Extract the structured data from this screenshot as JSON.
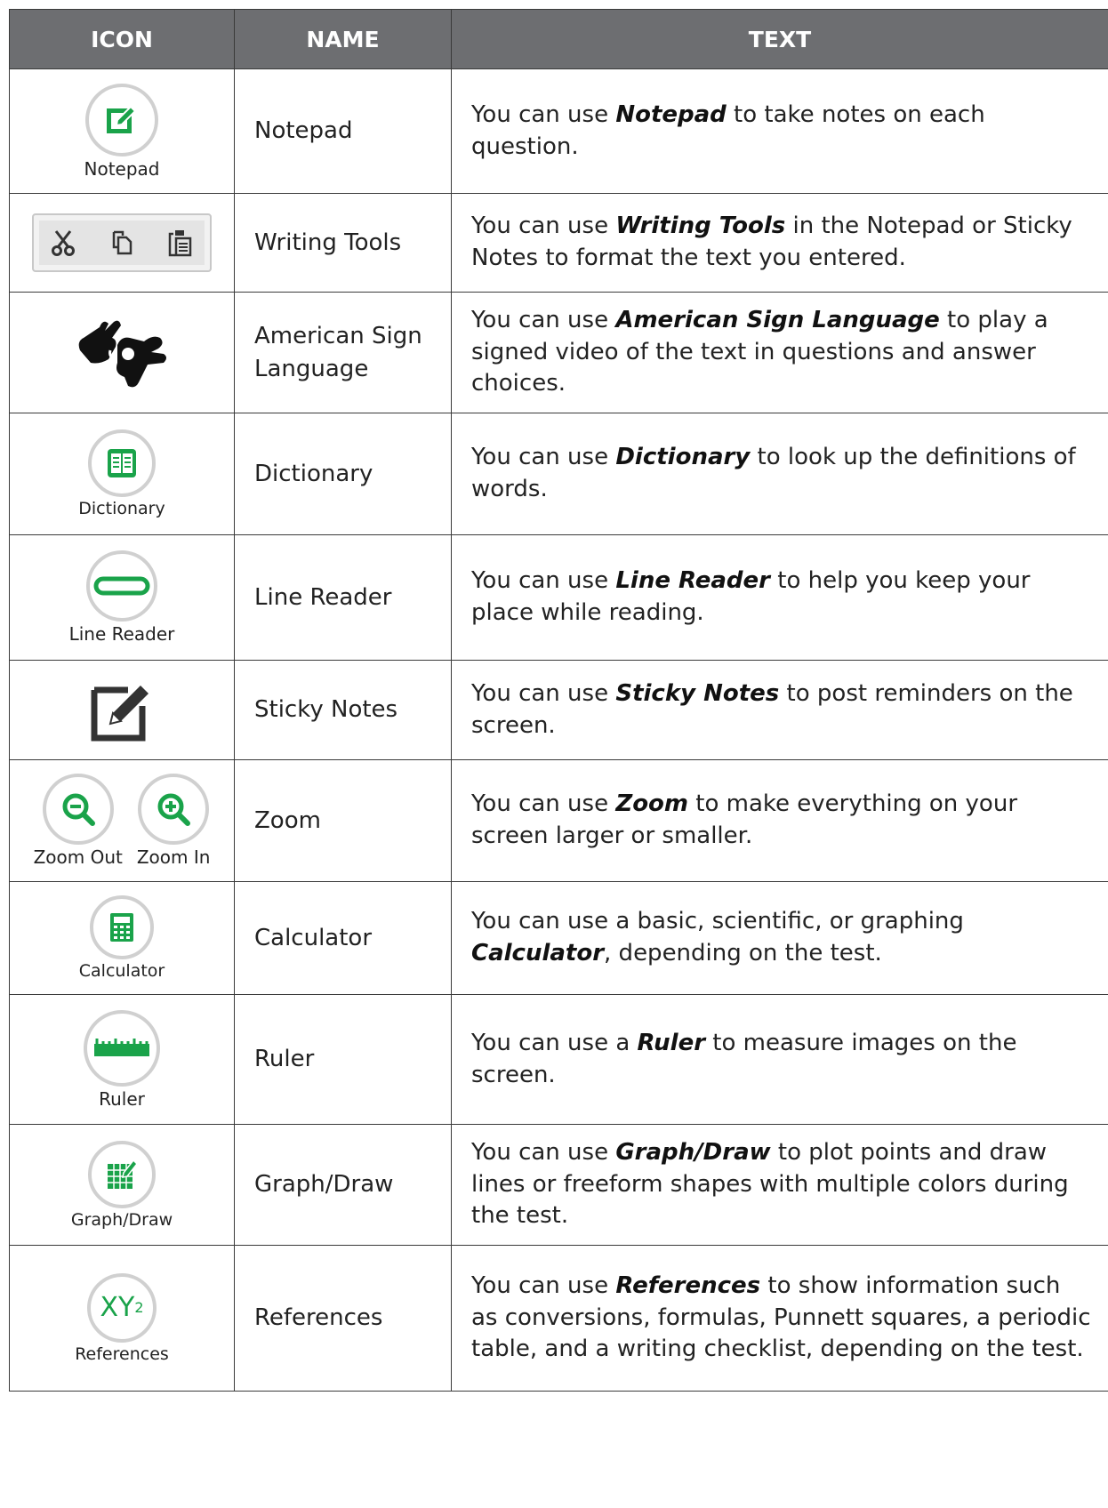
{
  "headers": {
    "icon": "ICON",
    "name": "NAME",
    "text": "TEXT"
  },
  "colors": {
    "header_bg": "#6d6e71",
    "accent_green": "#1aa34a",
    "circle_border": "#d0d0d0"
  },
  "rows": [
    {
      "icon_caption": "Notepad",
      "icon": "notepad-icon",
      "name": "Notepad",
      "text_pre": "You can use ",
      "text_bold": "Notepad",
      "text_post": " to take notes on each question."
    },
    {
      "icon": "writing-tools-icon",
      "name": "Writing Tools",
      "text_pre": "You can use ",
      "text_bold": "Writing Tools",
      "text_post": " in the Notepad or Sticky Notes to format the text you entered."
    },
    {
      "icon": "asl-hands-icon",
      "name": "American Sign Language",
      "text_pre": "You can use ",
      "text_bold": "American Sign Language",
      "text_post": " to play a signed video of the text in questions and answer choices."
    },
    {
      "icon_caption": "Dictionary",
      "icon": "dictionary-book-icon",
      "name": "Dictionary",
      "text_pre": "You can use ",
      "text_bold": "Dictionary",
      "text_post": " to look up the definitions of words."
    },
    {
      "icon_caption": "Line Reader",
      "icon": "line-reader-icon",
      "name": "Line Reader",
      "text_pre": "You can use ",
      "text_bold": "Line Reader",
      "text_post": " to help you keep your place while reading."
    },
    {
      "icon": "sticky-note-pencil-icon",
      "name": "Sticky Notes",
      "text_pre": "You can use ",
      "text_bold": "Sticky Notes",
      "text_post": " to post reminders on the screen."
    },
    {
      "icon_caption_out": "Zoom Out",
      "icon_caption_in": "Zoom In",
      "icon": "zoom-icons",
      "name": "Zoom",
      "text_pre": "You can use ",
      "text_bold": "Zoom",
      "text_post": " to make everything on your screen larger or smaller."
    },
    {
      "icon_caption": "Calculator",
      "icon": "calculator-icon",
      "name": "Calculator",
      "text_pre": "You can use a basic, scientific, or graphing ",
      "text_bold": "Calculator",
      "text_post": ", depending on the test."
    },
    {
      "icon_caption": "Ruler",
      "icon": "ruler-icon",
      "name": "Ruler",
      "text_pre": "You can use a ",
      "text_bold": "Ruler",
      "text_post": " to measure images on the screen."
    },
    {
      "icon_caption": "Graph/Draw",
      "icon": "graph-draw-icon",
      "name": "Graph/Draw",
      "text_pre": "You can use ",
      "text_bold": "Graph/Draw",
      "text_post": " to plot points and draw lines or freeform shapes with multiple colors during the test."
    },
    {
      "icon_caption": "References",
      "icon_text": "XY",
      "icon_sup": "2",
      "icon": "references-xy-icon",
      "name": "References",
      "text_pre": "You can use ",
      "text_bold": "References",
      "text_post": " to show information such as conversions, formulas, Punnett squares, a periodic table, and a writing checklist, depending on the test."
    }
  ]
}
